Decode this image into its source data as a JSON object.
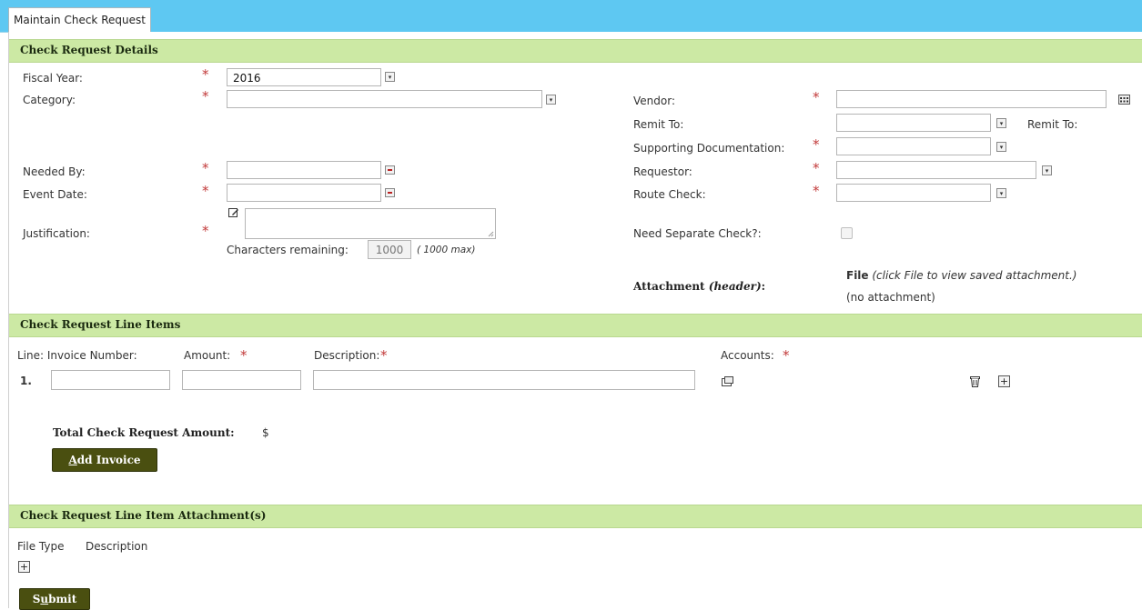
{
  "tab": {
    "label": "Maintain Check Request"
  },
  "details": {
    "header": "Check Request Details",
    "fiscal_year": {
      "label": "Fiscal Year:",
      "value": "2016"
    },
    "category": {
      "label": "Category:",
      "value": ""
    },
    "needed_by": {
      "label": "Needed By:"
    },
    "event_date": {
      "label": "Event Date:"
    },
    "justification": {
      "label": "Justification:",
      "chars_label": "Characters remaining:",
      "chars_value": "1000",
      "chars_max": "( 1000 max)"
    },
    "vendor": {
      "label": "Vendor:"
    },
    "remit_to": {
      "label": "Remit To:",
      "label2": "Remit To:"
    },
    "supporting_doc": {
      "label": "Supporting Documentation:"
    },
    "requestor": {
      "label": "Requestor:"
    },
    "route_check": {
      "label": "Route Check:"
    },
    "need_separate": {
      "label": "Need Separate Check?:"
    },
    "attachment": {
      "label_prefix": "Attachment ",
      "label_italic": "(header)",
      "label_suffix": ":",
      "file_bold": "File",
      "file_note": " (click File to view saved attachment.)",
      "none": "(no attachment)"
    }
  },
  "line_items": {
    "header": "Check Request Line Items",
    "col_line_invoice": "Line: Invoice Number:",
    "col_amount": "Amount:",
    "col_description": "Description:",
    "col_accounts": "Accounts:",
    "row_number": "1.",
    "total_label": "Total Check Request Amount:",
    "total_currency": "$",
    "add_invoice_first": "A",
    "add_invoice_rest": "dd Invoice"
  },
  "line_attachments": {
    "header": "Check Request Line Item Attachment(s)",
    "col_file_type": "File Type",
    "col_description": "Description"
  },
  "submit": {
    "first": "S",
    "underlined": "u",
    "rest": "bmit"
  },
  "required_mark": "*",
  "icons": {
    "plus": "+",
    "dropdown": "▾"
  },
  "colors": {
    "tabbar": "#5ec8f2",
    "section_header": "#cce9a4",
    "button": "#4a4f10",
    "required": "#c23a3a"
  }
}
